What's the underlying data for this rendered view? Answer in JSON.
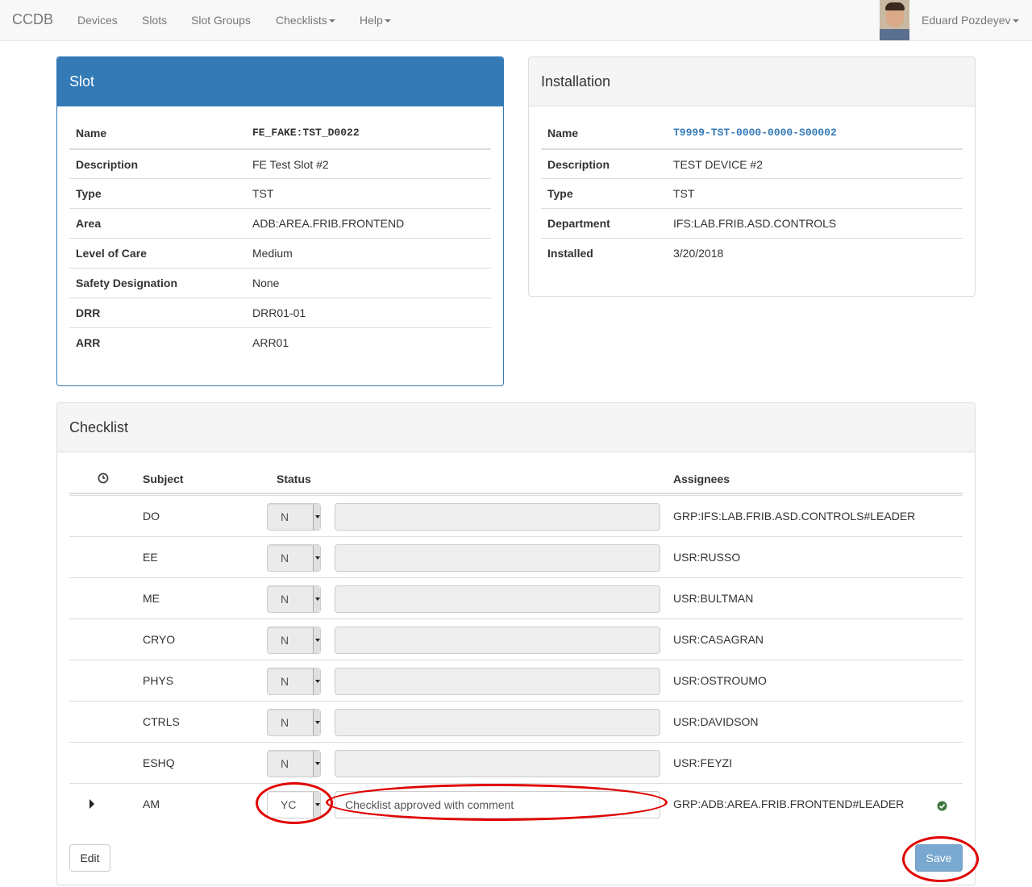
{
  "navbar": {
    "brand": "CCDB",
    "items": [
      "Devices",
      "Slots",
      "Slot Groups",
      "Checklists",
      "Help"
    ],
    "user": "Eduard Pozdeyev"
  },
  "slot": {
    "heading": "Slot",
    "rows": [
      {
        "label": "Name",
        "value": "FE_FAKE:TST_D0022"
      },
      {
        "label": "Description",
        "value": "FE Test Slot #2"
      },
      {
        "label": "Type",
        "value": "TST"
      },
      {
        "label": "Area",
        "value": "ADB:AREA.FRIB.FRONTEND"
      },
      {
        "label": "Level of Care",
        "value": "Medium"
      },
      {
        "label": "Safety Designation",
        "value": "None"
      },
      {
        "label": "DRR",
        "value": "DRR01-01"
      },
      {
        "label": "ARR",
        "value": "ARR01"
      }
    ]
  },
  "installation": {
    "heading": "Installation",
    "rows": [
      {
        "label": "Name",
        "value": "T9999-TST-0000-0000-S00002"
      },
      {
        "label": "Description",
        "value": "TEST DEVICE #2"
      },
      {
        "label": "Type",
        "value": "TST"
      },
      {
        "label": "Department",
        "value": "IFS:LAB.FRIB.ASD.CONTROLS"
      },
      {
        "label": "Installed",
        "value": "3/20/2018"
      }
    ]
  },
  "checklist": {
    "heading": "Checklist",
    "columns": {
      "subject": "Subject",
      "status": "Status",
      "assignees": "Assignees"
    },
    "rows": [
      {
        "subject": "DO",
        "status": "N",
        "comment": "",
        "assignee": "GRP:IFS:LAB.FRIB.ASD.CONTROLS#LEADER"
      },
      {
        "subject": "EE",
        "status": "N",
        "comment": "",
        "assignee": "USR:RUSSO"
      },
      {
        "subject": "ME",
        "status": "N",
        "comment": "",
        "assignee": "USR:BULTMAN"
      },
      {
        "subject": "CRYO",
        "status": "N",
        "comment": "",
        "assignee": "USR:CASAGRAN"
      },
      {
        "subject": "PHYS",
        "status": "N",
        "comment": "",
        "assignee": "USR:OSTROUMO"
      },
      {
        "subject": "CTRLS",
        "status": "N",
        "comment": "",
        "assignee": "USR:DAVIDSON"
      },
      {
        "subject": "ESHQ",
        "status": "N",
        "comment": "",
        "assignee": "USR:FEYZI"
      },
      {
        "subject": "AM",
        "status": "YC",
        "comment": "Checklist approved with comment",
        "assignee": "GRP:ADB:AREA.FRIB.FRONTEND#LEADER"
      }
    ],
    "edit_label": "Edit",
    "save_label": "Save"
  },
  "colors": {
    "primary": "#337ab7",
    "annotation": "#e00000",
    "success": "#3c763d"
  }
}
